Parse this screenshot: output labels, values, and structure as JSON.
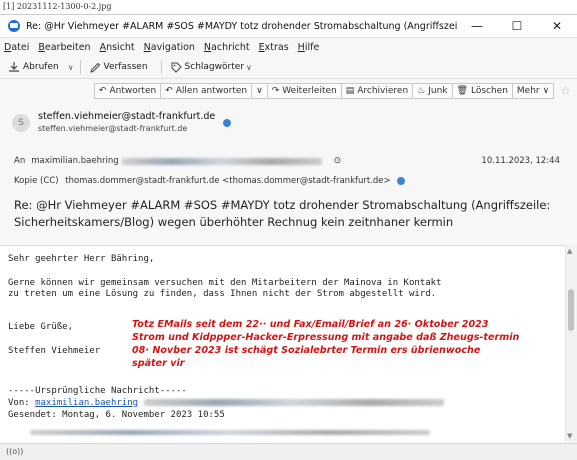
{
  "file_caption": "[1] 20231112-1300-0-2.jpg",
  "window": {
    "title": "Re: @Hr Viehmeyer #ALARM #SOS #MAYDY totz drohender Stromabschaltung (Angriffszeile: Si...",
    "minimize": "—",
    "maximize": "☐",
    "close": "✕"
  },
  "menu": [
    "Datei",
    "Bearbeiten",
    "Ansicht",
    "Navigation",
    "Nachricht",
    "Extras",
    "Hilfe"
  ],
  "toolbar": {
    "fetch_label": "Abrufen",
    "compose_label": "Verfassen",
    "tags_label": "Schlagwörter"
  },
  "actions": {
    "reply": "Antworten",
    "reply_all": "Allen antworten",
    "forward": "Weiterleiten",
    "archive": "Archivieren",
    "junk": "Junk",
    "delete": "Löschen",
    "more": "Mehr"
  },
  "sender": {
    "name": "steffen.viehmeier@stadt-frankfurt.de",
    "address": "steffen.viehmeier@stadt-frankfurt.de"
  },
  "to": {
    "label": "An",
    "value": "maximilian.baehring",
    "date": "10.11.2023, 12:44"
  },
  "cc": {
    "label": "Kopie (CC)",
    "value": "thomas.dommer@stadt-frankfurt.de <thomas.dommer@stadt-frankfurt.de>"
  },
  "subject": "Re: @Hr Viehmeyer #ALARM #SOS #MAYDY totz drohender Stromabschaltung (Angriffszeile: Sicherheitskamers/Blog) wegen überhöhter Rechnug kein zeitnhaner kermin",
  "body": {
    "greeting": "Sehr geehrter Herr Bähring,",
    "para1": "Gerne können wir gemeinsam versuchen mit den Mitarbeitern der Mainova in Kontakt",
    "para2": "zu treten um eine Lösung zu finden, dass Ihnen nicht der Strom abgestellt wird.",
    "regards": "Liebe Grüße,",
    "signature": "Steffen Viehmeier",
    "sep": "-----Ursprüngliche Nachricht-----",
    "from_label": "Von: ",
    "from_value": "maximilian.baehring",
    "sent": "Gesendet: Montag, 6. November 2023 10:55"
  },
  "annotation": [
    "Totz EMails seit dem 22·· und Fax/Email/Brief an 26· Oktober 2023",
    "Strom und Kidppper-Hacker-Erpressung mit angabe daß Zheugs-termin",
    "08· Novber 2023 ist schägt Sozialebrter Termin ers übrienwoche",
    "später vir"
  ],
  "status": "((o))",
  "colors": {
    "accent": "#1f6fd0",
    "annotation": "#d21414",
    "link": "#1a56b8"
  }
}
